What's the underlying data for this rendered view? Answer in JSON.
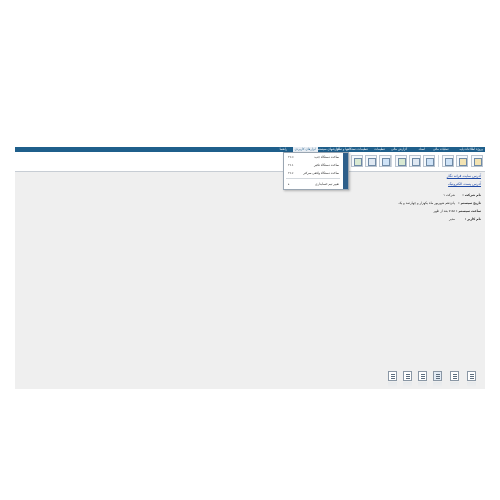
{
  "menu": {
    "items": [
      "پروژه اطلاعات پایه",
      "عملیات مالی",
      "اسناد",
      "گزارش مالی",
      "تنظیمات",
      "تنظیمات دستگاهها و تمام",
      "گزارشهای سیستم",
      "ابزارهای کاربردی",
      "راهنما"
    ],
    "active_index": 7,
    "active_label": "ابزارهای کاربردی",
    "submenu": {
      "items": [
        {
          "label": "ساخت دستگاه جدید",
          "shortcut": "F10"
        },
        {
          "label": "ساخت دستگاه تکثیر",
          "shortcut": "F11"
        },
        {
          "label": "ساخت دستگاه واقعی سرکتر",
          "shortcut": "F12"
        },
        {
          "label": "تغییر تیم حسابداری",
          "shortcut": "▸"
        }
      ]
    }
  },
  "toolbar": {
    "icons": [
      "exit-icon",
      "users-icon",
      "calculator-icon",
      "list-icon",
      "report-icon",
      "chart-icon",
      "cut-icon",
      "new-document-icon",
      "options-icon",
      "window-icon",
      "clipboard-icon"
    ]
  },
  "links": {
    "website": "آدرس سایت فرانه نگار",
    "email": "آدرس پست الکترونیک"
  },
  "info": [
    {
      "label": "نام شرکت :",
      "value": "شرکت ۱"
    },
    {
      "label": "تاریخ سیستم :",
      "value": "پانزدهم شهریور ماه یکهزار و چهارصد و یک"
    },
    {
      "label": "ساعت سیستم :",
      "value": "۷:۵۸ بعد از ظهر"
    },
    {
      "label": "نام کاربر :",
      "value": "مدیر"
    }
  ],
  "bottom_icons": [
    "import-icon",
    "export-icon",
    "grid-icon",
    "table-icon",
    "report-list-icon",
    "calendar-icon"
  ]
}
